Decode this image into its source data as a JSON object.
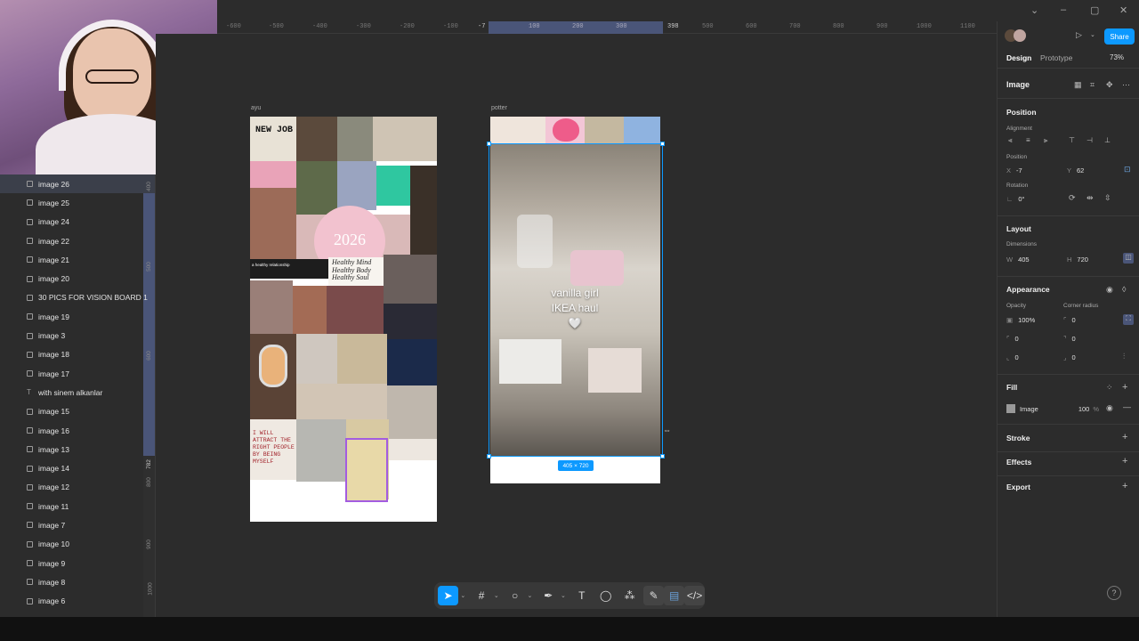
{
  "ruler": {
    "ticks": [
      "-600",
      "-500",
      "-400",
      "-300",
      "-200",
      "-100",
      "-7",
      "100",
      "200",
      "300",
      "398",
      "500",
      "600",
      "700",
      "800",
      "900",
      "1000",
      "1100"
    ]
  },
  "layers": {
    "items": [
      {
        "label": "image 26",
        "type": "image",
        "selected": true
      },
      {
        "label": "image 25",
        "type": "image"
      },
      {
        "label": "image 24",
        "type": "image"
      },
      {
        "label": "image 22",
        "type": "image"
      },
      {
        "label": "image 21",
        "type": "image"
      },
      {
        "label": "image 20",
        "type": "image"
      },
      {
        "label": "30 PICS FOR VISION BOARD 1",
        "type": "image"
      },
      {
        "label": "image 19",
        "type": "image"
      },
      {
        "label": "image 3",
        "type": "image"
      },
      {
        "label": "image 18",
        "type": "image"
      },
      {
        "label": "image 17",
        "type": "image"
      },
      {
        "label": "with sinem alkanlar",
        "type": "text"
      },
      {
        "label": "image 15",
        "type": "image"
      },
      {
        "label": "image 16",
        "type": "image"
      },
      {
        "label": "image 13",
        "type": "image"
      },
      {
        "label": "image 14",
        "type": "image"
      },
      {
        "label": "image 12",
        "type": "image"
      },
      {
        "label": "image 11",
        "type": "image"
      },
      {
        "label": "image 7",
        "type": "image"
      },
      {
        "label": "image 10",
        "type": "image"
      },
      {
        "label": "image 9",
        "type": "image"
      },
      {
        "label": "image 8",
        "type": "image"
      },
      {
        "label": "image 6",
        "type": "image"
      }
    ],
    "vertical_ruler": [
      "400",
      "500",
      "600",
      "782",
      "800",
      "900",
      "1000"
    ]
  },
  "canvas": {
    "frames": [
      {
        "label": "ayu"
      },
      {
        "label": "potter"
      }
    ],
    "collage": {
      "new_job": "NEW JOB",
      "year": "2026",
      "relationship": "a healthy relationship",
      "healthy": "Healthy Mind\nHealthy Body\nHealthy Soul",
      "attract": "I WILL ATTRACT THE RIGHT PEOPLE BY BEING MYSELF"
    },
    "overlay_text": "vanilla girl\nIKEA haul\n🤍",
    "size_badge": "405 × 720"
  },
  "properties": {
    "tabs": [
      "Design",
      "Prototype"
    ],
    "zoom": "73%",
    "share_label": "Share",
    "layer_title": "Image",
    "position": {
      "section": "Position",
      "alignment_label": "Alignment",
      "position_label": "Position",
      "x_key": "X",
      "x_value": "-7",
      "y_key": "Y",
      "y_value": "62",
      "rotation_label": "Rotation",
      "rotation_value": "0°"
    },
    "layout": {
      "section": "Layout",
      "dimensions_label": "Dimensions",
      "w_key": "W",
      "w_value": "405",
      "h_key": "H",
      "h_value": "720"
    },
    "appearance": {
      "section": "Appearance",
      "opacity_label": "Opacity",
      "opacity_value": "100%",
      "corner_label": "Corner radius",
      "corner_value": "0",
      "c1": "0",
      "c2": "0",
      "c3": "0",
      "c4": "0"
    },
    "fill": {
      "section": "Fill",
      "type": "Image",
      "opacity": "100",
      "unit": "%"
    },
    "stroke": "Stroke",
    "effects": "Effects",
    "export": "Export"
  },
  "toolbar": {
    "tools": [
      "move",
      "frame",
      "shape",
      "pen",
      "text",
      "comment",
      "components",
      "dev"
    ]
  },
  "colors": {
    "accent": "#0d99ff",
    "panel": "#2c2c2c",
    "selection": "#4a5578"
  }
}
